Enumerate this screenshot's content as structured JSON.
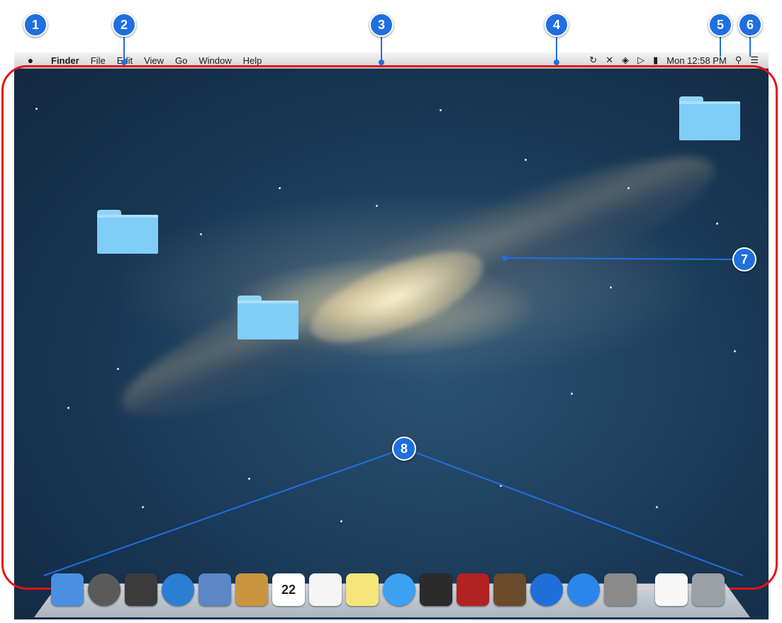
{
  "menubar": {
    "apple_icon": "apple-icon",
    "menus": [
      "Finder",
      "File",
      "Edit",
      "View",
      "Go",
      "Window",
      "Help"
    ],
    "status_icons": [
      "time-machine-icon",
      "bluetooth-icon",
      "wifi-icon",
      "volume-icon",
      "battery-icon"
    ],
    "clock": "Mon 12:58 PM",
    "spotlight_icon": "spotlight-search-icon",
    "notification_icon": "notification-center-icon"
  },
  "callouts": [
    "1",
    "2",
    "3",
    "4",
    "5",
    "6",
    "7",
    "8"
  ],
  "desktop": {
    "folders": [
      "folder-icon",
      "folder-icon",
      "folder-icon"
    ]
  },
  "dock": {
    "apps": [
      {
        "icon": "finder-icon",
        "color": "#4a90e2"
      },
      {
        "icon": "launchpad-icon",
        "color": "#5a5a5a"
      },
      {
        "icon": "mission-control-icon",
        "color": "#3b3b3b"
      },
      {
        "icon": "safari-icon",
        "color": "#2a7fd4"
      },
      {
        "icon": "mail-icon",
        "color": "#5b87c7"
      },
      {
        "icon": "contacts-icon",
        "color": "#c9953f"
      },
      {
        "icon": "calendar-icon",
        "color": "#ffffff",
        "label": "22"
      },
      {
        "icon": "reminders-icon",
        "color": "#f5f5f5"
      },
      {
        "icon": "notes-icon",
        "color": "#f4e67a"
      },
      {
        "icon": "messages-icon",
        "color": "#3da1f2"
      },
      {
        "icon": "facetime-icon",
        "color": "#2b2b2b"
      },
      {
        "icon": "photo-booth-icon",
        "color": "#b22222"
      },
      {
        "icon": "iphoto-icon",
        "color": "#6a4b2a"
      },
      {
        "icon": "itunes-icon",
        "color": "#1e6fd9"
      },
      {
        "icon": "app-store-icon",
        "color": "#2a86e8"
      },
      {
        "icon": "system-preferences-icon",
        "color": "#8a8a8a"
      },
      {
        "icon": "document-icon",
        "color": "#f7f7f7"
      },
      {
        "icon": "trash-icon",
        "color": "#9aa0a6"
      }
    ]
  }
}
